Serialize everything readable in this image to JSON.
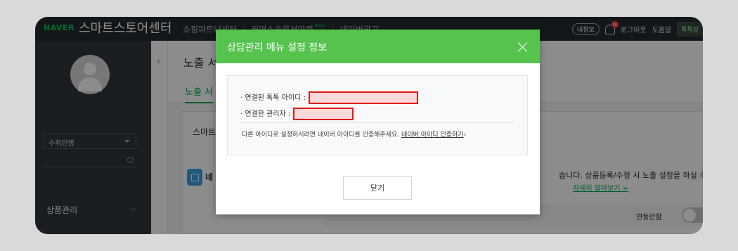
{
  "header": {
    "naver": "NAVER",
    "brand": "스마트스토어센터",
    "nav": [
      "쇼핑파트너센터",
      "커머스솔루션마켓",
      "네이버광고"
    ],
    "beta": "Beta",
    "info_pill": "내정보",
    "notification_badge": "N",
    "logout": "로그아웃",
    "help": "도움말",
    "talk_button": "톡톡상"
  },
  "sidebar": {
    "store_select": "수취인명",
    "menu_item": "상품관리"
  },
  "content": {
    "page_title": "노출 서",
    "subtab": "노출 서",
    "card_title": "스마트스",
    "app_label": "네",
    "side_text": "습니다. 상품등록/수정 시 노출 설정을 하실 수",
    "side_link": "자세히 알아보기 >",
    "toggle_label": "연동안함"
  },
  "modal": {
    "title": "상담관리 메뉴 설정 정보",
    "row1_label": "· 연결된 톡톡 아이디 :",
    "row2_label": "· 연결한 관리자 :",
    "hint_text": "다른 아이디로 설정하시려면 네이버 아이디를 인증해주세요.",
    "hint_link": "네이버 아이디 인증하기",
    "close_button": "닫기"
  },
  "colors": {
    "modal_header": "#56c34f",
    "redaction_border": "#e01b1b",
    "sidebar_bg": "#30373f",
    "topbar_bg": "#262b31"
  }
}
